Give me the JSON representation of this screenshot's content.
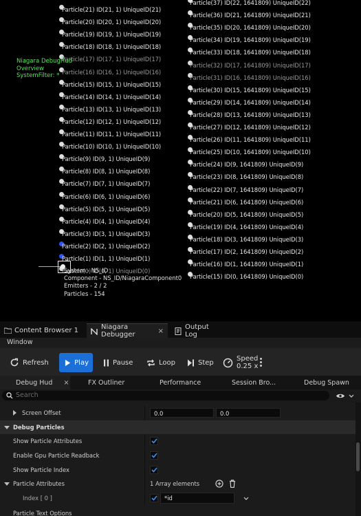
{
  "viewport": {
    "overview": [
      "Niagara DebugHud",
      "Overview",
      "SystemFilter: *"
    ],
    "left_column": [
      {
        "text": "Particle(21) ID(21, 1) UniqueID(21)",
        "dim": false
      },
      {
        "text": "Particle(20) ID(20, 1) UniqueID(20)",
        "dim": false
      },
      {
        "text": "Particle(19) ID(19, 1) UniqueID(19)",
        "dim": false
      },
      {
        "text": "Particle(18) ID(18, 1) UniqueID(18)",
        "dim": false
      },
      {
        "text": "Particle(17) ID(17, 1) UniqueID(17)",
        "dim": true
      },
      {
        "text": "Particle(16) ID(16, 1) UniqueID(16)",
        "dim": true
      },
      {
        "text": "Particle(15) ID(15, 1) UniqueID(15)",
        "dim": false
      },
      {
        "text": "Particle(14) ID(14, 1) UniqueID(14)",
        "dim": false
      },
      {
        "text": "Particle(13) ID(13, 1) UniqueID(13)",
        "dim": false
      },
      {
        "text": "Particle(12) ID(12, 1) UniqueID(12)",
        "dim": false
      },
      {
        "text": "Particle(11) ID(11, 1) UniqueID(11)",
        "dim": false
      },
      {
        "text": "Particle(10) ID(10, 1) UniqueID(10)",
        "dim": false
      },
      {
        "text": "Particle(9) ID(9, 1) UniqueID(9)",
        "dim": false
      },
      {
        "text": "Particle(8) ID(8, 1) UniqueID(8)",
        "dim": false
      },
      {
        "text": "Particle(7) ID(7, 1) UniqueID(7)",
        "dim": false
      },
      {
        "text": "Particle(6) ID(6, 1) UniqueID(6)",
        "dim": false
      },
      {
        "text": "Particle(5) ID(5, 1) UniqueID(5)",
        "dim": false
      },
      {
        "text": "Particle(4) ID(4, 1) UniqueID(4)",
        "dim": false
      },
      {
        "text": "Particle(3) ID(3, 1) UniqueID(3)",
        "dim": false
      },
      {
        "text": "Particle(2) ID(2, 1) UniqueID(2)",
        "dim": false
      },
      {
        "text": "Particle(1) ID(1, 1) UniqueID(1)",
        "dim": false
      },
      {
        "text": "Particle(0) ID(0, 1) UniqueID(0)",
        "dim": true
      }
    ],
    "right_column": [
      {
        "text": "Particle(37) ID(22, 1641809) UniqueID(22)",
        "dim": false
      },
      {
        "text": "Particle(36) ID(21, 1641809) UniqueID(21)",
        "dim": false
      },
      {
        "text": "Particle(35) ID(20, 1641809) UniqueID(20)",
        "dim": false
      },
      {
        "text": "Particle(34) ID(19, 1641809) UniqueID(19)",
        "dim": false
      },
      {
        "text": "Particle(33) ID(18, 1641809) UniqueID(18)",
        "dim": false
      },
      {
        "text": "Particle(32) ID(17, 1641809) UniqueID(17)",
        "dim": true
      },
      {
        "text": "Particle(31) ID(16, 1641809) UniqueID(16)",
        "dim": true
      },
      {
        "text": "Particle(30) ID(15, 1641809) UniqueID(15)",
        "dim": false
      },
      {
        "text": "Particle(29) ID(14, 1641809) UniqueID(14)",
        "dim": false
      },
      {
        "text": "Particle(28) ID(13, 1641809) UniqueID(13)",
        "dim": false
      },
      {
        "text": "Particle(27) ID(12, 1641809) UniqueID(12)",
        "dim": false
      },
      {
        "text": "Particle(26) ID(11, 1641809) UniqueID(11)",
        "dim": false
      },
      {
        "text": "Particle(25) ID(10, 1641809) UniqueID(10)",
        "dim": false
      },
      {
        "text": "Particle(24) ID(9, 1641809) UniqueID(9)",
        "dim": false
      },
      {
        "text": "Particle(23) ID(8, 1641809) UniqueID(8)",
        "dim": false
      },
      {
        "text": "Particle(22) ID(7, 1641809) UniqueID(7)",
        "dim": false
      },
      {
        "text": "Particle(21) ID(6, 1641809) UniqueID(6)",
        "dim": false
      },
      {
        "text": "Particle(20) ID(5, 1641809) UniqueID(5)",
        "dim": false
      },
      {
        "text": "Particle(19) ID(4, 1641809) UniqueID(4)",
        "dim": false
      },
      {
        "text": "Particle(18) ID(3, 1641809) UniqueID(3)",
        "dim": false
      },
      {
        "text": "Particle(17) ID(2, 1641809) UniqueID(2)",
        "dim": false
      },
      {
        "text": "Particle(16) ID(1, 1641809) UniqueID(1)",
        "dim": false
      },
      {
        "text": "Particle(15) ID(0, 1641809) UniqueID(0)",
        "dim": false
      }
    ],
    "system_info": [
      "System - NS_ID",
      "Component - NS_ID/NiagaraComponent0",
      "Emitters - 2 / 2",
      "Particles - 154"
    ]
  },
  "tabs": {
    "content_browser": "Content Browser 1",
    "niagara_debugger": "Niagara Debugger",
    "close": "×",
    "output_log": "Output Log"
  },
  "menu": {
    "window": "Window"
  },
  "toolbar": {
    "refresh": "Refresh",
    "play": "Play",
    "pause": "Pause",
    "loop": "Loop",
    "step": "Step",
    "speed_label": "Speed",
    "speed_value": "0.25 x"
  },
  "subtabs": {
    "debug_hud": "Debug Hud",
    "close": "×",
    "fx_outliner": "FX Outliner",
    "performance": "Performance",
    "session_browser": "Session Bro...",
    "debug_spawn": "Debug Spawn"
  },
  "search": {
    "placeholder": "Search"
  },
  "details": {
    "screen_offset": {
      "label": "Screen Offset",
      "x": "0.0",
      "y": "0.0"
    },
    "debug_particles": "Debug Particles",
    "show_particle_attributes": "Show Particle Attributes",
    "enable_gpu_readback": "Enable Gpu Particle Readback",
    "show_particle_index": "Show Particle Index",
    "particle_attributes": {
      "label": "Particle Attributes",
      "count": "1 Array elements"
    },
    "index0": {
      "label": "Index [ 0 ]",
      "value": "*id"
    },
    "next_row": "Particle Text Options"
  },
  "colors": {
    "accent": "#1b6fd6",
    "hud_green": "#4fe84f",
    "viewport": "#000000"
  }
}
